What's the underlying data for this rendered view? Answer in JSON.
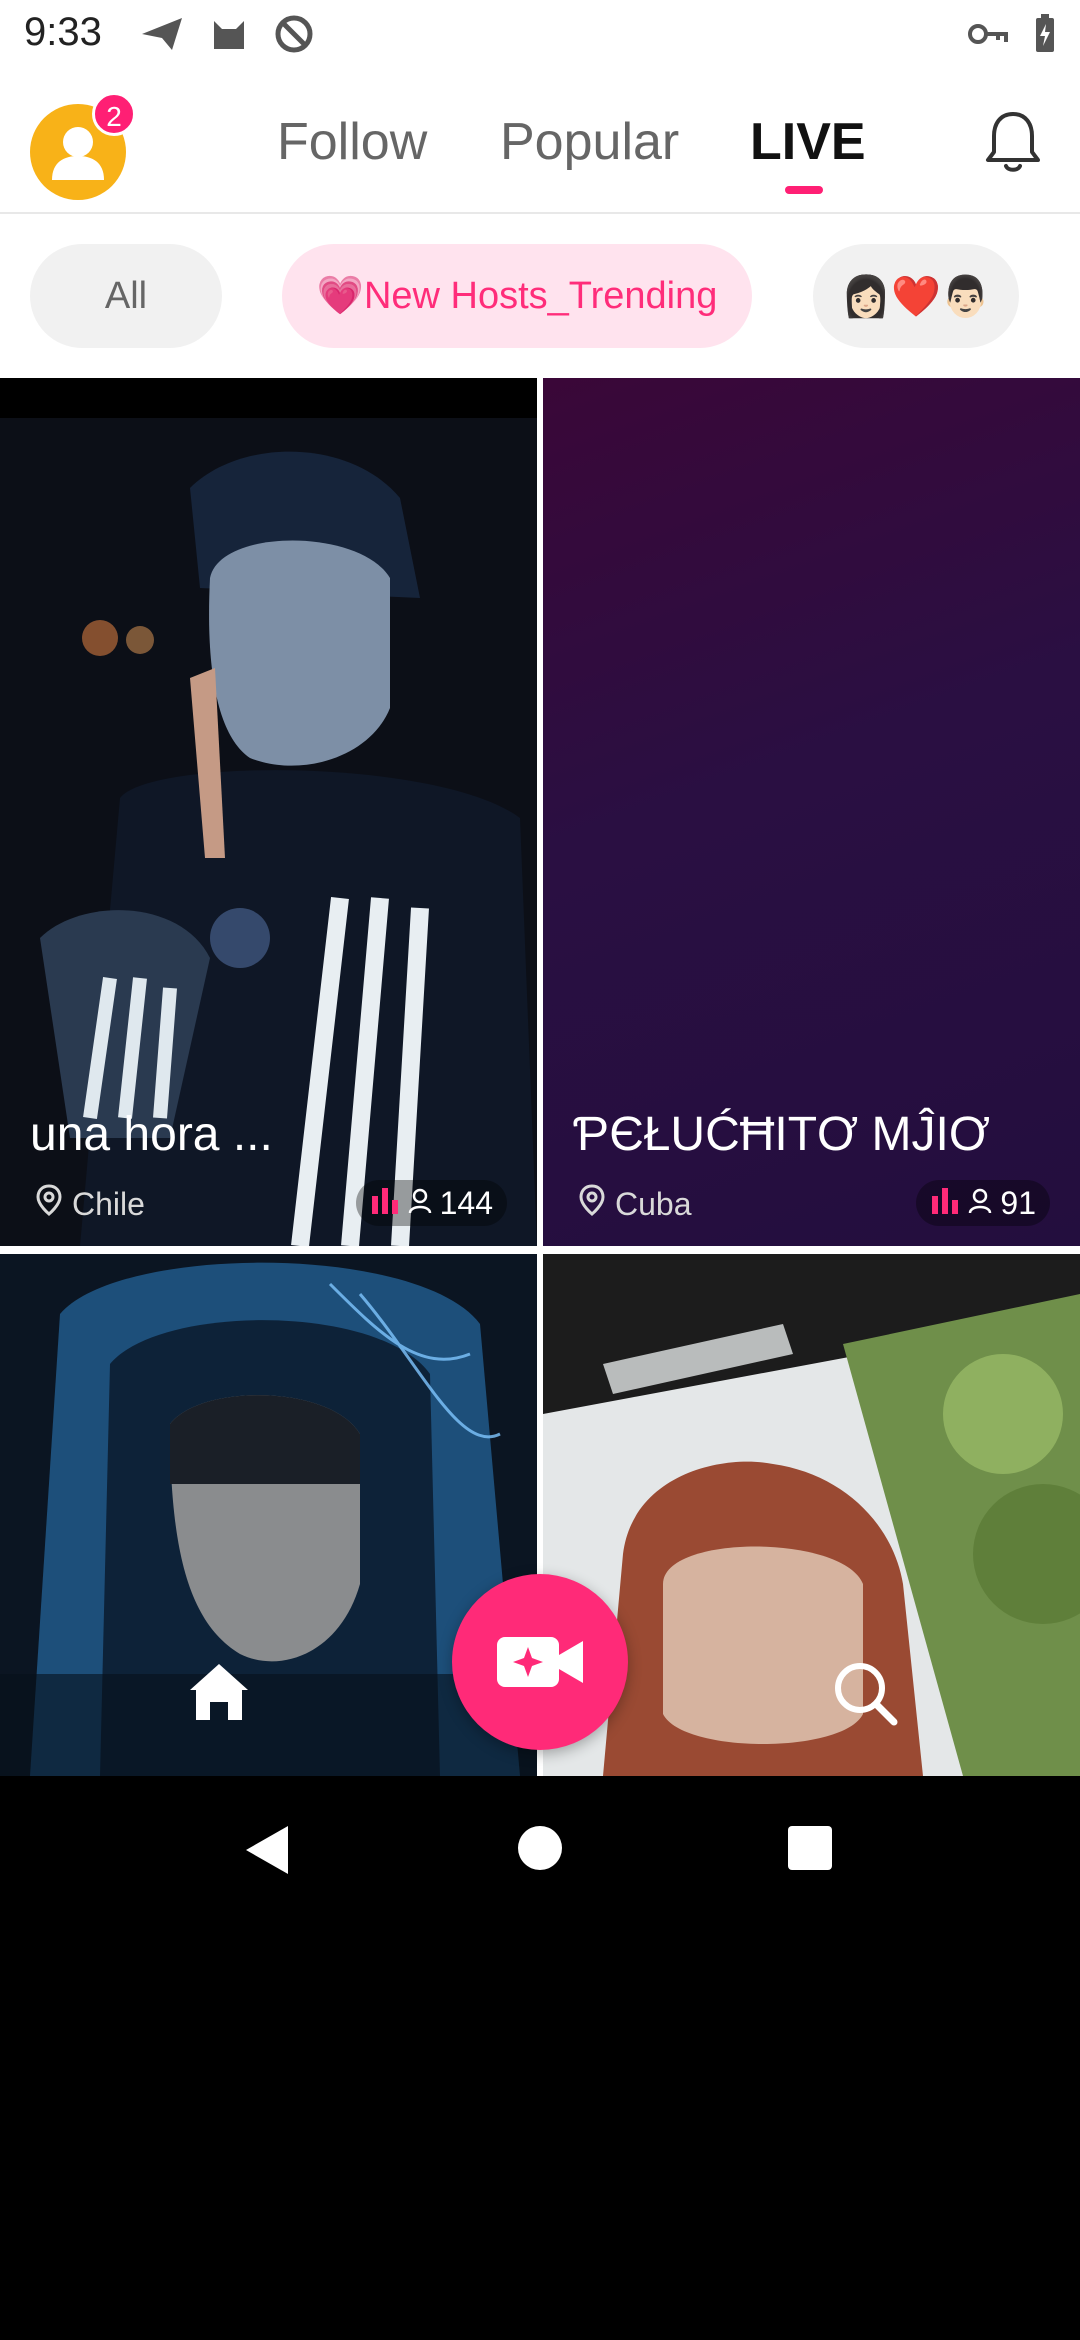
{
  "status_bar": {
    "time": "9:33",
    "icons": [
      "send-icon",
      "cat-icon",
      "at-icon",
      "key-icon",
      "battery-charging-icon"
    ]
  },
  "header": {
    "avatar_badge": "2",
    "tabs": [
      {
        "label": "Follow",
        "active": false
      },
      {
        "label": "Popular",
        "active": false
      },
      {
        "label": "LIVE",
        "active": true
      }
    ],
    "accent_color": "#ff1f74"
  },
  "filters": {
    "all_label": "All",
    "trending_label": "New Hosts_Trending",
    "trending_emoji": "💗",
    "couple_emoji": "👩🏻❤️👨🏻"
  },
  "streams": [
    {
      "title": "una hora ...",
      "location": "Chile",
      "viewers": "144"
    },
    {
      "title": "ƤЄŁUĆĦITƠ MĴIƠ",
      "location": "Cuba",
      "viewers": "91"
    },
    {
      "title": "",
      "location": "",
      "viewers": ""
    },
    {
      "title": "",
      "location": "",
      "viewers": ""
    }
  ],
  "bottom_nav": {
    "items": [
      "home-icon",
      "go-live-icon",
      "search-icon"
    ],
    "go_live_color": "#ff2a78"
  }
}
